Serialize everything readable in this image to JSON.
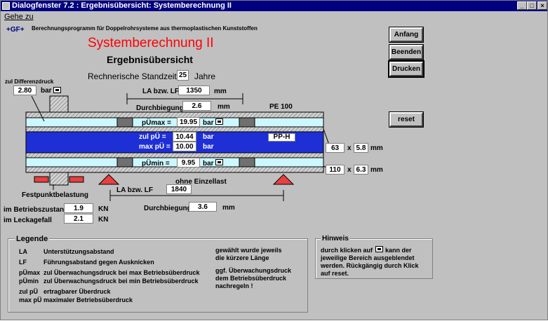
{
  "window": {
    "title": "Dialogfenster  7.2 : Ergebnisübersicht: Systemberechnung II",
    "min": "_",
    "max": "□",
    "close": "×"
  },
  "menu": {
    "gehe_zu": "Gehe zu"
  },
  "logo": "+GF+",
  "subtitle": "Berechnungsprogramm für Doppelrohrsysteme aus thermoplastischen Kunststoffen",
  "heading": "Systemberechnung II",
  "subheading": "Ergebnisübersicht",
  "standzeit": {
    "label": "Rechnerische Standzeit",
    "value": "25",
    "unit": "Jahre"
  },
  "buttons": {
    "anfang": "Anfang",
    "beenden": "Beenden",
    "drucken": "Drucken",
    "reset": "reset"
  },
  "diff": {
    "label": "zul Differenzdruck",
    "value": "2.80",
    "unit": "bar"
  },
  "la_top": {
    "label": "LA bzw. LF",
    "value": "1350",
    "unit": "mm"
  },
  "durch_top": {
    "label": "Durchbiegung",
    "value": "2.6",
    "unit": "mm"
  },
  "outer_mat": "PE 100",
  "inner_mat": "PP-H",
  "pumax": {
    "label": "pÜmax =",
    "value": "19.95",
    "unit": "bar"
  },
  "zulpu": {
    "label": "zul pÜ =",
    "value": "10.44",
    "unit": "bar"
  },
  "maxpu": {
    "label": "max pÜ =",
    "value": "10.00",
    "unit": "bar"
  },
  "pumin": {
    "label": "pÜmin =",
    "value": "9.95",
    "unit": "bar"
  },
  "inner_dim": {
    "d": "63",
    "x": "x",
    "s": "5.8",
    "unit": "mm"
  },
  "outer_dim": {
    "d": "110",
    "x": "x",
    "s": "6.3",
    "unit": "mm"
  },
  "einzellast": "ohne Einzellast",
  "la_bot": {
    "label": "LA bzw. LF",
    "value": "1840"
  },
  "durch_bot": {
    "label": "Durchbiegung",
    "value": "3.6",
    "unit": "mm"
  },
  "festpunkt": "Festpunktbelastung",
  "betrieb": {
    "label": "im Betriebszustand",
    "value": "1.9",
    "unit": "KN"
  },
  "leckage": {
    "label": "im Leckagefall",
    "value": "2.1",
    "unit": "KN"
  },
  "legende": {
    "title": "Legende",
    "rows": [
      {
        "k": "LA",
        "v": "Unterstützungsabstand"
      },
      {
        "k": "LF",
        "v": "Führungsabstand gegen Ausknicken"
      },
      {
        "k": "pÜmax",
        "v": "zul Überwachungsdruck bei max Betriebsüberdruck"
      },
      {
        "k": "pÜmin",
        "v": "zul Überwachungsdruck bei min Betriebsüberdruck"
      },
      {
        "k": "zul pÜ",
        "v": "ertragbarer Überdruck"
      },
      {
        "k": "max pÜ",
        "v": "maximaler Betriebsüberdruck"
      }
    ],
    "note1a": "gewählt wurde jeweils",
    "note1b": "die kürzere Länge",
    "note2a": "ggf. Überwachungsdruck",
    "note2b": "dem Betriebsüberdruck",
    "note2c": "nachregeln !"
  },
  "hinweis": {
    "title": "Hinweis",
    "l1a": "durch klicken auf",
    "l1b": "kann der",
    "l2": "jeweilige Bereich ausgeblendet",
    "l3": "werden. Rückgängig durch Klick",
    "l4": "auf reset."
  },
  "colors": {
    "title_bg": "#000080",
    "heading": "#ff0000",
    "pipe_blue": "#1f2fd6",
    "light_cyan": "#ccf7ff",
    "support": "#e84040"
  }
}
